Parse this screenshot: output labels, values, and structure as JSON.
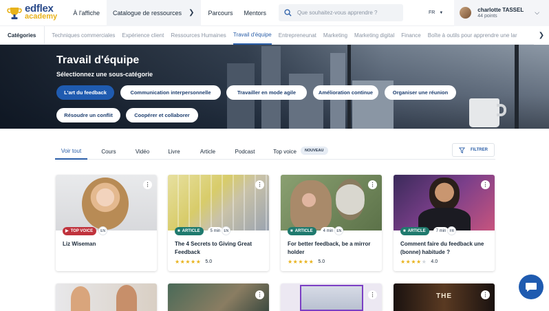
{
  "header": {
    "logo_top": "edflex",
    "logo_bottom": "academy",
    "nav": {
      "affiche": "À l'affiche",
      "catalogue": "Catalogue de ressources",
      "parcours": "Parcours",
      "mentors": "Mentors"
    },
    "search_placeholder": "Que souhaitez-vous apprendre ?",
    "language": "FR",
    "user_name": "charlotte TASSEL",
    "user_points": "44 points"
  },
  "categories": {
    "label": "Catégories",
    "items": [
      "Techniques commerciales",
      "Expérience client",
      "Ressources Humaines",
      "Travail d'équipe",
      "Entrepreneunat",
      "Marketing",
      "Marketing digital",
      "Finance",
      "Boîte à outils pour apprendre une lar"
    ],
    "active_index": 3
  },
  "hero": {
    "title": "Travail d'équipe",
    "subtitle": "Sélectionnez une sous-catégorie",
    "chips": [
      "L'art du feedback",
      "Communication interpersonnelle",
      "Travailler en mode agile",
      "Amélioration continue",
      "Organiser une réunion",
      "Résoudre un conflit",
      "Coopérer et collaborer"
    ],
    "active_chip": 0
  },
  "tabs": {
    "items": [
      "Voir tout",
      "Cours",
      "Vidéo",
      "Livre",
      "Article",
      "Podcast",
      "Top voice"
    ],
    "new_badge": "NOUVEAU",
    "active_index": 0,
    "filter_label": "FILTRER"
  },
  "cards": [
    {
      "type_label": "TOP VOICE",
      "type": "voice",
      "duration": "",
      "lang": "EN",
      "title": "Liz Wiseman",
      "rating": null,
      "rating_text": ""
    },
    {
      "type_label": "ARTICLE",
      "type": "article",
      "duration": "5 min",
      "lang": "EN",
      "title": "The 4 Secrets to Giving Great Feedback",
      "rating": 5,
      "rating_text": "5.0"
    },
    {
      "type_label": "ARTICLE",
      "type": "article",
      "duration": "4 min",
      "lang": "EN",
      "title": "For better feedback, be a mirror holder",
      "rating": 5,
      "rating_text": "5.0"
    },
    {
      "type_label": "ARTICLE",
      "type": "article",
      "duration": "7 min",
      "lang": "FR",
      "title": "Comment faire du feedback une (bonne) habitude ?",
      "rating": 4,
      "rating_text": "4.0"
    }
  ],
  "bottom_cards": [
    {
      "overlay_text": ""
    },
    {
      "overlay_text": ""
    },
    {
      "overlay_text": ""
    },
    {
      "overlay_text": "THE"
    }
  ],
  "colors": {
    "brand_blue": "#1f5bb0",
    "active_link": "#2a5ea8",
    "article_green": "#1f7a6e",
    "top_voice_red": "#c0333d",
    "star": "#e8b21b"
  }
}
